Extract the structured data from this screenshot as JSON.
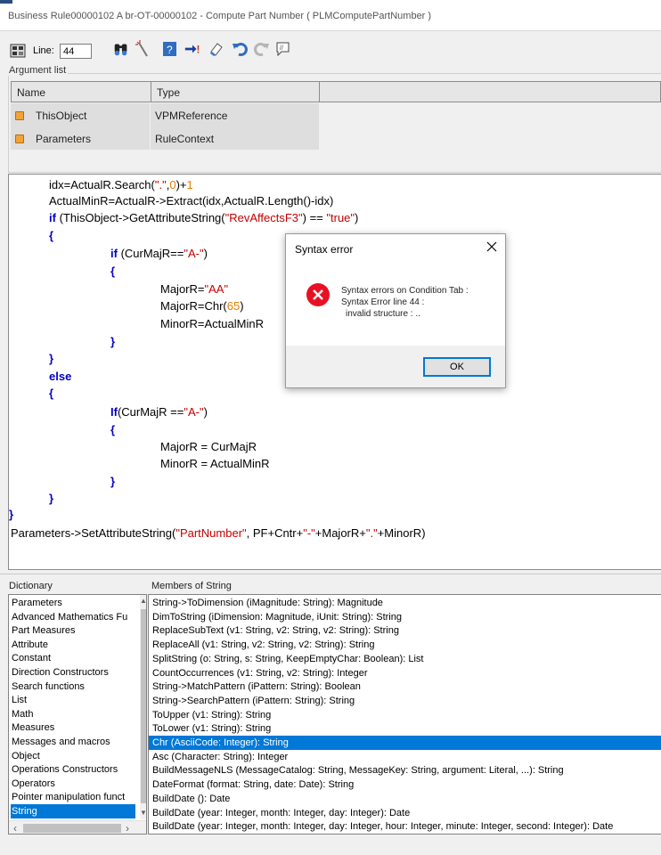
{
  "window": {
    "title": "Business Rule00000102 A br-OT-00000102 - Compute Part Number  ( PLMComputePartNumber )"
  },
  "toolbar": {
    "line_label": "Line:",
    "line_value": "44",
    "icons": [
      "catalog-icon",
      "find-icon",
      "wand-icon",
      "help-icon",
      "goto-icon",
      "eraser-icon",
      "undo-icon",
      "redo-icon",
      "comment-icon"
    ]
  },
  "arguments": {
    "legend": "Argument list",
    "columns": [
      "Name",
      "Type"
    ],
    "rows": [
      {
        "name": "ThisObject",
        "type": "VPMReference"
      },
      {
        "name": "Parameters",
        "type": "RuleContext"
      }
    ]
  },
  "code": {
    "lines": [
      [
        {
          "t": "idx=ActualR.Search(",
          "c": ""
        },
        {
          "t": "\".\"",
          "c": "str"
        },
        {
          "t": ",",
          "c": ""
        },
        {
          "t": "0",
          "c": "num"
        },
        {
          "t": ")+",
          "c": ""
        },
        {
          "t": "1",
          "c": "num"
        }
      ],
      [
        {
          "t": "ActualMinR=ActualR->Extract(idx,ActualR.Length()-idx)",
          "c": ""
        }
      ],
      [
        {
          "t": "if",
          "c": "kw"
        },
        {
          "t": " (ThisObject->GetAttributeString(",
          "c": ""
        },
        {
          "t": "\"RevAffectsF3\"",
          "c": "str"
        },
        {
          "t": ") == ",
          "c": ""
        },
        {
          "t": "\"true\"",
          "c": "str"
        },
        {
          "t": ")",
          "c": ""
        }
      ],
      [
        {
          "t": "{",
          "c": "kw"
        }
      ],
      [
        {
          "t": "if",
          "c": "kw"
        },
        {
          "t": " (CurMajR==",
          "c": ""
        },
        {
          "t": "\"A-\"",
          "c": "str"
        },
        {
          "t": ")",
          "c": ""
        }
      ],
      [
        {
          "t": "{",
          "c": "kw"
        }
      ],
      [
        {
          "t": "MajorR=",
          "c": ""
        },
        {
          "t": "\"AA\"",
          "c": "str"
        }
      ],
      [
        {
          "t": "MajorR=Chr(",
          "c": ""
        },
        {
          "t": "65",
          "c": "num"
        },
        {
          "t": ")",
          "c": ""
        }
      ],
      [
        {
          "t": "MinorR=ActualMinR",
          "c": ""
        }
      ],
      [
        {
          "t": "}",
          "c": "kw"
        }
      ],
      [
        {
          "t": "}",
          "c": "kw"
        }
      ],
      [
        {
          "t": "else",
          "c": "kw"
        }
      ],
      [
        {
          "t": "{",
          "c": "kw"
        }
      ],
      [
        {
          "t": "If",
          "c": "kw"
        },
        {
          "t": "(CurMajR ==",
          "c": ""
        },
        {
          "t": "\"A-\"",
          "c": "str"
        },
        {
          "t": ")",
          "c": ""
        }
      ],
      [
        {
          "t": "{",
          "c": "kw"
        }
      ],
      [
        {
          "t": "MajorR = CurMajR",
          "c": ""
        }
      ],
      [
        {
          "t": "MinorR = ActualMinR",
          "c": ""
        }
      ],
      [
        {
          "t": "}",
          "c": "kw"
        }
      ],
      [
        {
          "t": "}",
          "c": "kw"
        }
      ],
      [
        {
          "t": "}",
          "c": "kw"
        }
      ],
      [
        {
          "t": "Parameters->SetAttributeString(",
          "c": ""
        },
        {
          "t": "\"PartNumber\"",
          "c": "str"
        },
        {
          "t": ", PF+Cntr+",
          "c": ""
        },
        {
          "t": "\"-\"",
          "c": "str"
        },
        {
          "t": "+MajorR+",
          "c": ""
        },
        {
          "t": "\".\"",
          "c": "str"
        },
        {
          "t": "+MinorR)",
          "c": ""
        }
      ]
    ]
  },
  "dialog": {
    "title": "Syntax error",
    "messages": [
      "Syntax errors on Condition Tab :",
      "Syntax Error line 44 :",
      "invalid structure : .."
    ],
    "ok_label": "OK"
  },
  "dictionary": {
    "label": "Dictionary",
    "items": [
      "Parameters",
      "Advanced Mathematics Fu",
      "Part Measures",
      "Attribute",
      "Constant",
      "Direction Constructors",
      "Search functions",
      "List",
      "Math",
      "Measures",
      "Messages and macros",
      "Object",
      "Operations Constructors",
      "Operators",
      "Pointer manipulation funct",
      "String"
    ],
    "selected": "String"
  },
  "members": {
    "label": "Members of String",
    "items": [
      "String->ToDimension (iMagnitude: String): Magnitude",
      "DimToString (iDimension: Magnitude, iUnit: String): String",
      "ReplaceSubText (v1: String, v2: String, v2: String): String",
      "ReplaceAll (v1: String, v2: String, v2: String): String",
      "SplitString (o: String, s: String, KeepEmptyChar: Boolean): List",
      "CountOccurrences (v1: String, v2: String): Integer",
      "String->MatchPattern (iPattern: String): Boolean",
      "String->SearchPattern (iPattern: String): String",
      "ToUpper (v1: String): String",
      "ToLower (v1: String): String",
      "Chr (AsciiCode: Integer): String",
      "Asc (Character: String): Integer",
      "BuildMessageNLS (MessageCatalog: String, MessageKey: String, argument: Literal, ...): String",
      "DateFormat (format: String, date: Date): String",
      "BuildDate (): Date",
      "BuildDate (year: Integer, month: Integer, day: Integer): Date",
      "BuildDate (year: Integer, month: Integer, day: Integer, hour: Integer, minute: Integer, second: Integer): Date"
    ],
    "selected": "Chr (AsciiCode: Integer): String"
  },
  "colors": {
    "keyword": "#0000c8",
    "string": "#c40000",
    "number": "#e67e00",
    "selection": "#0078d7",
    "error": "#e81123"
  }
}
